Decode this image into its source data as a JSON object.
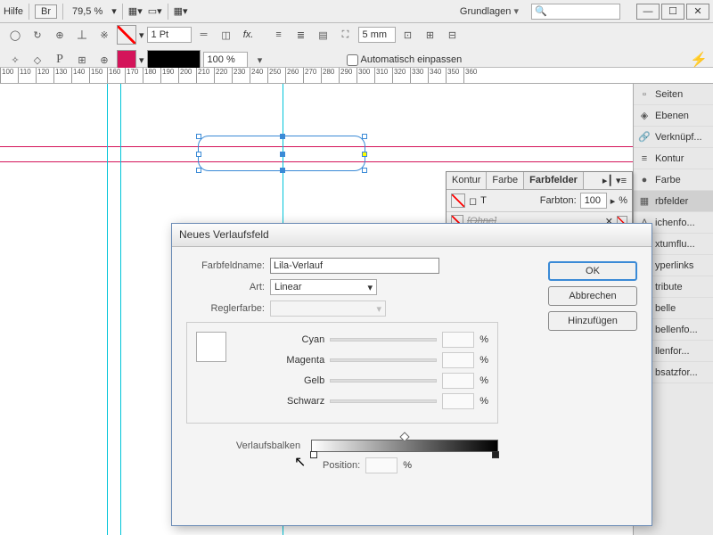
{
  "topbar": {
    "help": "Hilfe",
    "br": "Br",
    "zoom": "79,5 %",
    "workspace": "Grundlagen"
  },
  "toolbar": {
    "stroke_weight": "1 Pt",
    "opacity": "100 %",
    "inset": "5 mm",
    "autofit": "Automatisch einpassen"
  },
  "ruler": [
    "100",
    "110",
    "120",
    "130",
    "140",
    "150",
    "160",
    "170",
    "180",
    "190",
    "200",
    "210",
    "220",
    "230",
    "240",
    "250",
    "260",
    "270",
    "280",
    "290",
    "300",
    "310",
    "320",
    "330",
    "340",
    "350",
    "360"
  ],
  "rpanel": [
    "Seiten",
    "Ebenen",
    "Verknüpf...",
    "Kontur",
    "Farbe",
    "rbfelder",
    "ichenfo...",
    "xtumflu...",
    "yperlinks",
    "tribute",
    "belle",
    "bellenfo...",
    "llenfor...",
    "bsatzfor..."
  ],
  "rpanel_active": 5,
  "swatch_panel": {
    "tabs": [
      "Kontur",
      "Farbe",
      "Farbfelder"
    ],
    "active": 2,
    "tint_label": "Farbton:",
    "tint_val": "100",
    "tint_unit": "%",
    "row": "[Ohne]"
  },
  "dialog": {
    "title": "Neues Verlaufsfeld",
    "name_label": "Farbfeldname:",
    "name_val": "Lila-Verlauf",
    "type_label": "Art:",
    "type_val": "Linear",
    "stopcolor_label": "Reglerfarbe:",
    "colors": [
      "Cyan",
      "Magenta",
      "Gelb",
      "Schwarz"
    ],
    "pct": "%",
    "ramp_label": "Verlaufsbalken",
    "pos_label": "Position:",
    "ok": "OK",
    "cancel": "Abbrechen",
    "add": "Hinzufügen"
  }
}
